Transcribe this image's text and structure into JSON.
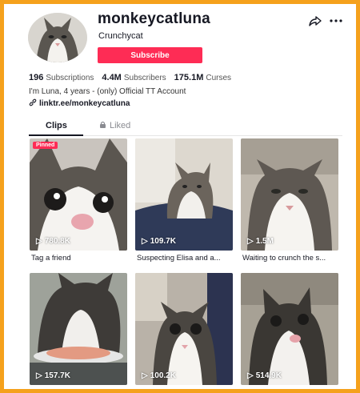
{
  "profile": {
    "username": "monkeycatluna",
    "nickname": "Crunchycat",
    "subscribe_label": "Subscribe",
    "bio": "I'm Luna, 4 years - (only) Official TT Account",
    "link": "linktr.ee/monkeycatluna"
  },
  "stats": [
    {
      "value": "196",
      "label": "Subscriptions"
    },
    {
      "value": "4.4M",
      "label": "Subscribers"
    },
    {
      "value": "175.1M",
      "label": "Curses"
    }
  ],
  "tabs": {
    "clips": "Clips",
    "liked": "Liked"
  },
  "videos": [
    {
      "views": "780.8K",
      "caption": "Tag a friend",
      "badge": "Pinned"
    },
    {
      "views": "109.7K",
      "caption": "Suspecting Elisa and a..."
    },
    {
      "views": "1.5M",
      "caption": "Waiting to crunch the s..."
    },
    {
      "views": "157.7K",
      "caption": ""
    },
    {
      "views": "100.2K",
      "caption": ""
    },
    {
      "views": "514.9K",
      "caption": ""
    }
  ],
  "colors": {
    "accent": "#fe2c55",
    "frame": "#f5a11c"
  },
  "icons": [
    "share-icon",
    "more-icon",
    "link-icon",
    "lock-icon",
    "play-icon"
  ]
}
